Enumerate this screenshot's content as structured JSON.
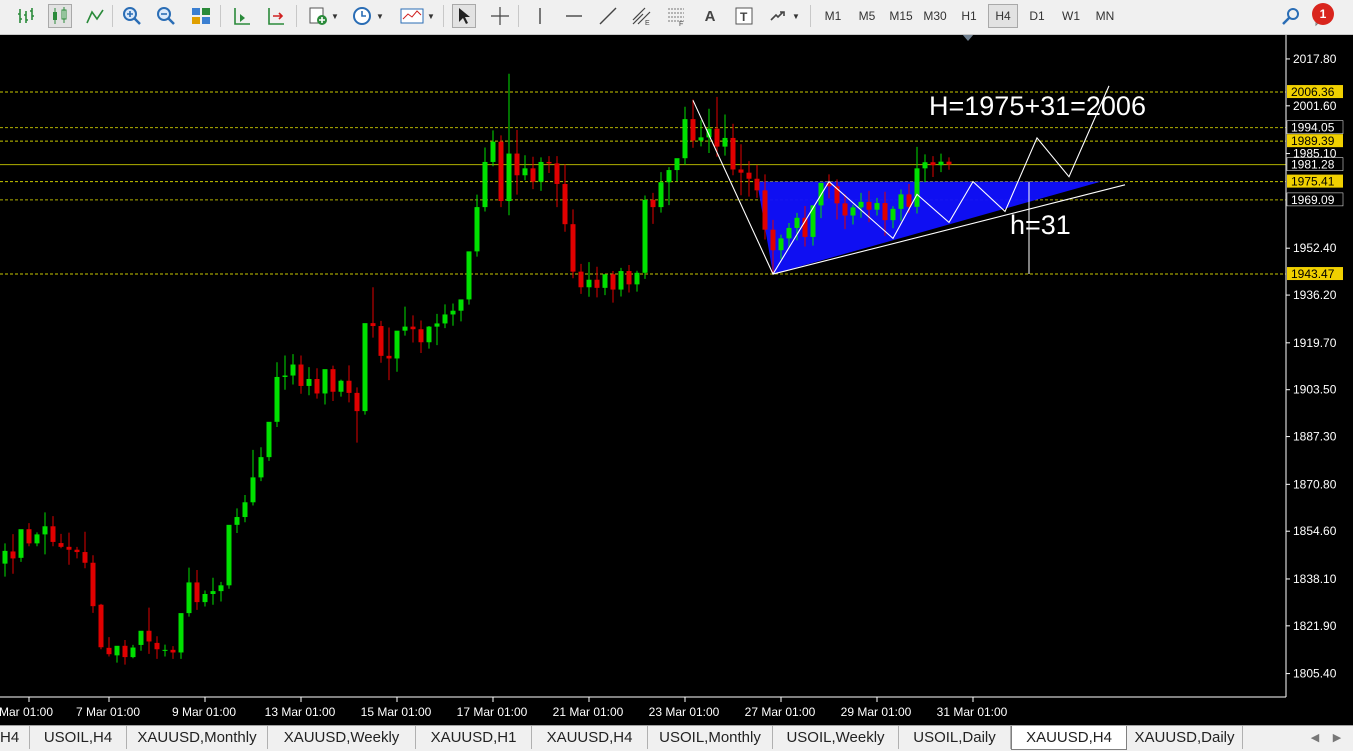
{
  "toolbar": {
    "timeframes": [
      "M1",
      "M5",
      "M15",
      "M30",
      "H1",
      "H4",
      "D1",
      "W1",
      "MN"
    ],
    "active_timeframe": "H4",
    "notification_count": "1",
    "icons": [
      "bar-chart-icon",
      "candlestick-chart-icon",
      "line-chart-icon",
      "zoom-in-icon",
      "zoom-out-icon",
      "tile-windows-icon",
      "chart-shift-icon",
      "auto-scroll-icon",
      "new-order-icon",
      "periods-clock-icon",
      "templates-icon",
      "cursor-icon",
      "crosshair-icon",
      "vertical-line-icon",
      "horizontal-line-icon",
      "trendline-icon",
      "equidistant-channel-icon",
      "fibonacci-icon",
      "text-icon",
      "text-label-icon",
      "arrows-icon",
      "search-icon",
      "notification-icon"
    ]
  },
  "chart": {
    "symbol": "XAUUSD",
    "timeframe": "H4",
    "background": "#000000",
    "bull_color": "#00e000",
    "bear_color": "#e00000",
    "grid_level_color": "#c8c800",
    "pattern_fill": "#1010ff",
    "annotations": [
      {
        "text": "H=1975+31=2006"
      },
      {
        "text": "h=31"
      }
    ]
  },
  "chart_data": {
    "type": "candlestick",
    "y_ticks": [
      "2017.80",
      "2001.60",
      "1985.10",
      "1952.40",
      "1936.20",
      "1919.70",
      "1903.50",
      "1887.30",
      "1870.80",
      "1854.60",
      "1838.10",
      "1821.90",
      "1805.40"
    ],
    "x_ticks": [
      "Mar 01:00",
      "7 Mar 01:00",
      "9 Mar 01:00",
      "13 Mar 01:00",
      "15 Mar 01:00",
      "17 Mar 01:00",
      "21 Mar 01:00",
      "23 Mar 01:00",
      "27 Mar 01:00",
      "29 Mar 01:00",
      "31 Mar 01:00"
    ],
    "price_labels": [
      {
        "value": "2006.36",
        "highlight": true
      },
      {
        "value": "1994.05",
        "highlight": false
      },
      {
        "value": "1989.39",
        "highlight": true
      },
      {
        "value": "1981.28",
        "highlight": false
      },
      {
        "value": "1975.41",
        "highlight": true
      },
      {
        "value": "1969.09",
        "highlight": false
      },
      {
        "value": "1943.47",
        "highlight": true
      }
    ],
    "levels": [
      2006.36,
      1994.05,
      1989.39,
      1981.28,
      1975.41,
      1969.09,
      1943.47
    ],
    "triangle": {
      "top_level": 1975.41,
      "apex_low": 1943.47,
      "height": 31,
      "target": 2006
    },
    "candles": [
      [
        1845.5,
        1848.0,
        1843.2,
        1841.0
      ],
      [
        1843.4,
        1850.4,
        1847.8,
        1838.9
      ],
      [
        1847.6,
        1853.6,
        1845.2,
        1839.9
      ],
      [
        1845.4,
        1850.3,
        1855.3,
        1844.0
      ],
      [
        1855.3,
        1857.4,
        1850.4,
        1849.4
      ],
      [
        1850.4,
        1854.2,
        1853.5,
        1849.4
      ],
      [
        1853.5,
        1861.1,
        1856.3,
        1846.6
      ],
      [
        1856.3,
        1859.8,
        1850.9,
        1849.4
      ],
      [
        1850.5,
        1853.7,
        1849.2,
        1848.7
      ],
      [
        1849.2,
        1854.1,
        1848.2,
        1843.0
      ],
      [
        1848.2,
        1849.2,
        1847.4,
        1845.2
      ],
      [
        1847.4,
        1854.4,
        1843.7,
        1841.8
      ],
      [
        1843.7,
        1846.3,
        1828.7,
        1826.4
      ],
      [
        1829.2,
        1829.5,
        1814.5,
        1813.8
      ],
      [
        1814.3,
        1818.0,
        1812.1,
        1811.3
      ],
      [
        1811.7,
        1814.7,
        1815.0,
        1809.2
      ],
      [
        1815.0,
        1817.0,
        1811.1,
        1808.5
      ],
      [
        1811.1,
        1815.3,
        1814.4,
        1810.7
      ],
      [
        1815.3,
        1819.5,
        1820.2,
        1813.3
      ],
      [
        1820.2,
        1828.2,
        1816.5,
        1812.2
      ],
      [
        1816.0,
        1818.3,
        1813.8,
        1810.5
      ],
      [
        1813.5,
        1815.4,
        1813.6,
        1811.3
      ],
      [
        1813.6,
        1814.9,
        1812.7,
        1810.5
      ],
      [
        1812.7,
        1823.4,
        1826.3,
        1810.5
      ],
      [
        1826.3,
        1842.0,
        1836.9,
        1825.1
      ],
      [
        1836.9,
        1841.2,
        1830.1,
        1827.4
      ],
      [
        1830.1,
        1834.1,
        1832.9,
        1828.6
      ],
      [
        1832.9,
        1838.5,
        1833.9,
        1829.2
      ],
      [
        1833.9,
        1837.1,
        1835.9,
        1830.3
      ],
      [
        1835.9,
        1842.2,
        1856.8,
        1834.7
      ],
      [
        1856.8,
        1862.5,
        1859.5,
        1854.0
      ],
      [
        1859.5,
        1867.1,
        1864.6,
        1857.7
      ],
      [
        1864.6,
        1882.7,
        1873.2,
        1863.5
      ],
      [
        1873.2,
        1883.6,
        1880.2,
        1871.9
      ],
      [
        1880.2,
        1887.2,
        1892.4,
        1878.9
      ],
      [
        1892.4,
        1913.0,
        1907.9,
        1890.6
      ],
      [
        1907.9,
        1915.3,
        1908.4,
        1903.5
      ],
      [
        1908.4,
        1915.8,
        1912.2,
        1905.3
      ],
      [
        1912.2,
        1915.3,
        1904.8,
        1902.1
      ],
      [
        1904.8,
        1911.3,
        1907.2,
        1901.6
      ],
      [
        1907.2,
        1910.9,
        1902.2,
        1900.4
      ],
      [
        1902.2,
        1904.2,
        1910.6,
        1898.4
      ],
      [
        1910.6,
        1911.8,
        1902.8,
        1899.6
      ],
      [
        1902.8,
        1907.0,
        1906.6,
        1901.1
      ],
      [
        1906.6,
        1911.9,
        1902.4,
        1899.1
      ],
      [
        1902.4,
        1904.3,
        1896.1,
        1885.2
      ],
      [
        1896.1,
        1900.5,
        1926.5,
        1894.9
      ],
      [
        1926.5,
        1938.9,
        1925.5,
        1921.5
      ],
      [
        1925.5,
        1927.3,
        1915.2,
        1912.8
      ],
      [
        1915.2,
        1925.0,
        1914.3,
        1906.8
      ],
      [
        1914.3,
        1922.7,
        1923.9,
        1909.7
      ],
      [
        1923.9,
        1932.2,
        1925.3,
        1922.2
      ],
      [
        1925.3,
        1929.2,
        1924.4,
        1919.8
      ],
      [
        1924.4,
        1927.4,
        1919.9,
        1916.2
      ],
      [
        1919.9,
        1925.5,
        1925.3,
        1917.7
      ],
      [
        1925.3,
        1929.7,
        1926.4,
        1918.9
      ],
      [
        1926.4,
        1933.0,
        1929.5,
        1924.8
      ],
      [
        1929.5,
        1933.3,
        1930.8,
        1925.6
      ],
      [
        1930.8,
        1932.4,
        1934.7,
        1927.1
      ],
      [
        1934.7,
        1937.2,
        1951.3,
        1932.9
      ],
      [
        1951.3,
        1970.9,
        1966.6,
        1949.5
      ],
      [
        1966.6,
        1987.2,
        1982.2,
        1965.1
      ],
      [
        1982.2,
        1993.1,
        1989.2,
        1980.7
      ],
      [
        1989.2,
        1991.4,
        1968.7,
        1966.6
      ],
      [
        1968.7,
        2012.7,
        1985.1,
        1963.8
      ],
      [
        1985.1,
        1993.3,
        1977.6,
        1970.9
      ],
      [
        1977.6,
        1984.5,
        1980.0,
        1975.9
      ],
      [
        1980.0,
        1984.0,
        1975.4,
        1972.8
      ],
      [
        1975.4,
        1983.8,
        1982.2,
        1972.2
      ],
      [
        1982.2,
        1984.2,
        1981.7,
        1978.4
      ],
      [
        1981.7,
        1984.2,
        1974.6,
        1966.6
      ],
      [
        1974.6,
        1981.4,
        1960.7,
        1958.1
      ],
      [
        1960.7,
        1965.8,
        1944.3,
        1942.0
      ],
      [
        1944.3,
        1947.0,
        1938.9,
        1936.6
      ],
      [
        1938.9,
        1947.6,
        1941.5,
        1935.6
      ],
      [
        1941.5,
        1946.0,
        1938.7,
        1935.4
      ],
      [
        1938.7,
        1943.1,
        1943.4,
        1936.2
      ],
      [
        1943.4,
        1944.5,
        1938.1,
        1933.6
      ],
      [
        1938.1,
        1945.6,
        1944.5,
        1935.7
      ],
      [
        1944.5,
        1946.6,
        1939.9,
        1937.1
      ],
      [
        1939.9,
        1944.6,
        1943.9,
        1937.4
      ],
      [
        1943.9,
        1970.6,
        1969.1,
        1941.8
      ],
      [
        1969.1,
        1971.5,
        1966.6,
        1960.8
      ],
      [
        1966.6,
        1978.7,
        1975.2,
        1964.7
      ],
      [
        1975.2,
        1980.4,
        1979.4,
        1967.3
      ],
      [
        1979.4,
        1982.1,
        1983.5,
        1975.5
      ],
      [
        1983.5,
        2001.3,
        1997.0,
        1981.2
      ],
      [
        1997.0,
        2003.8,
        1989.6,
        1987.1
      ],
      [
        1989.6,
        1996.6,
        1990.7,
        1987.6
      ],
      [
        1990.7,
        2000.6,
        1993.7,
        1985.3
      ],
      [
        1993.7,
        2004.7,
        1987.5,
        1984.0
      ],
      [
        1987.5,
        1998.6,
        1990.5,
        1984.4
      ],
      [
        1990.5,
        1995.4,
        1979.6,
        1977.6
      ],
      [
        1979.6,
        1988.3,
        1978.5,
        1970.7
      ],
      [
        1978.5,
        1982.5,
        1976.4,
        1970.2
      ],
      [
        1976.4,
        1981.2,
        1972.4,
        1969.8
      ],
      [
        1972.4,
        1977.9,
        1958.8,
        1955.4
      ],
      [
        1958.8,
        1962.2,
        1951.7,
        1944.0
      ],
      [
        1951.7,
        1957.1,
        1955.8,
        1948.7
      ],
      [
        1955.8,
        1961.1,
        1959.4,
        1952.5
      ],
      [
        1959.4,
        1964.6,
        1962.9,
        1955.1
      ],
      [
        1962.9,
        1967.0,
        1956.3,
        1953.0
      ],
      [
        1956.3,
        1962.1,
        1967.2,
        1953.3
      ],
      [
        1967.2,
        1974.0,
        1975.0,
        1962.8
      ],
      [
        1975.0,
        1977.9,
        1973.8,
        1969.6
      ],
      [
        1973.8,
        1976.2,
        1967.9,
        1962.3
      ],
      [
        1967.9,
        1971.1,
        1963.7,
        1959.0
      ],
      [
        1963.7,
        1967.4,
        1966.5,
        1960.6
      ],
      [
        1966.5,
        1971.5,
        1968.4,
        1962.9
      ],
      [
        1968.4,
        1972.2,
        1965.7,
        1961.4
      ],
      [
        1965.7,
        1969.8,
        1968.0,
        1963.7
      ],
      [
        1968.0,
        1971.9,
        1962.1,
        1956.7
      ],
      [
        1962.1,
        1966.9,
        1966.0,
        1959.3
      ],
      [
        1966.0,
        1972.7,
        1971.0,
        1961.8
      ],
      [
        1971.0,
        1974.6,
        1966.7,
        1964.6
      ],
      [
        1966.7,
        1987.4,
        1980.0,
        1964.4
      ],
      [
        1980.0,
        1984.8,
        1982.1,
        1975.2
      ],
      [
        1982.1,
        1984.2,
        1981.1,
        1977.0
      ],
      [
        1981.1,
        1985.1,
        1982.3,
        1978.7
      ],
      [
        1982.3,
        1983.8,
        1981.3,
        1979.5
      ]
    ],
    "candle_format": [
      "open",
      "high",
      "close",
      "low"
    ],
    "y_range": [
      1798.0,
      2024.0
    ]
  },
  "tabs": {
    "items": [
      "H4",
      "USOIL,H4",
      "XAUUSD,Monthly",
      "XAUUSD,Weekly",
      "XAUUSD,H1",
      "XAUUSD,H4",
      "USOIL,Monthly",
      "USOIL,Weekly",
      "USOIL,Daily",
      "XAUUSD,H4",
      "XAUUSD,Daily"
    ],
    "active_index": 9
  }
}
